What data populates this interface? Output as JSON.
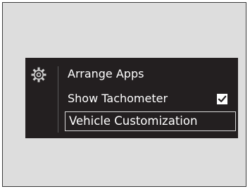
{
  "menu": {
    "settings_icon": "gear-icon",
    "items": [
      {
        "label": "Arrange Apps"
      },
      {
        "label": "Show Tachometer",
        "checked": true,
        "checkbox_icon": "checkmark-icon"
      },
      {
        "label": "Vehicle Customization",
        "selected": true
      }
    ]
  },
  "colors": {
    "background": "#dddddd",
    "menu_background": "#231f20",
    "text": "#ffffff",
    "selection_border": "#d8d8d8"
  }
}
